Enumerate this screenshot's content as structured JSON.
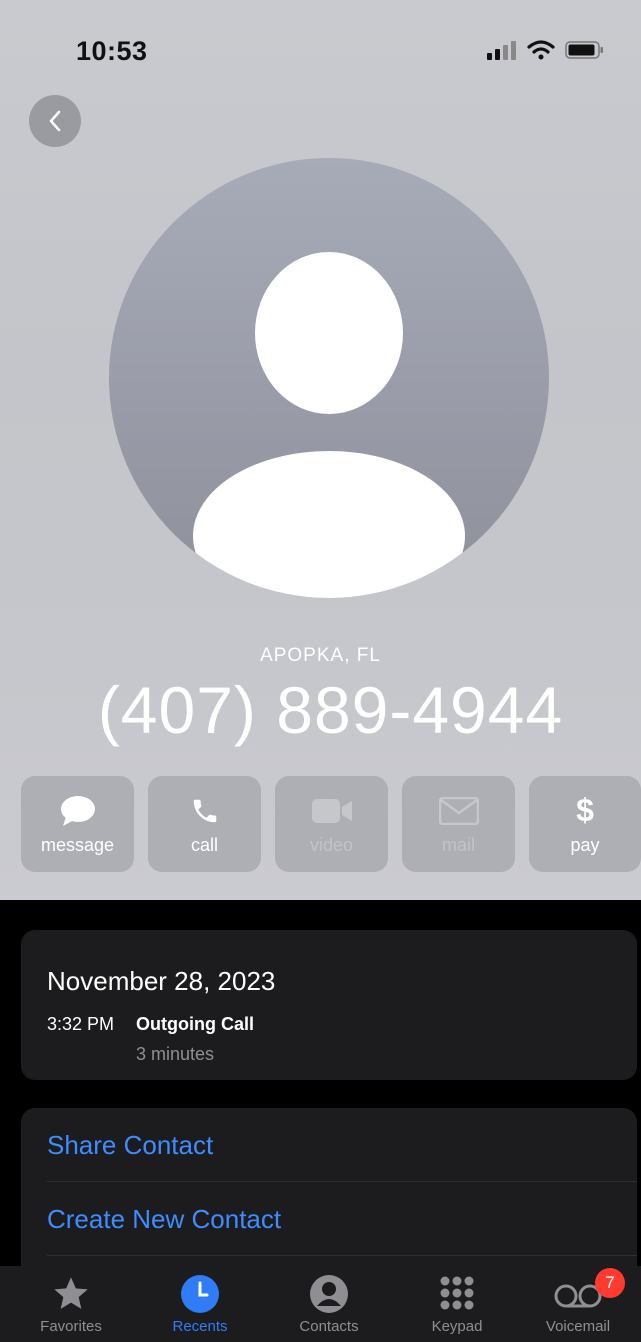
{
  "status_bar": {
    "time": "10:53"
  },
  "contact": {
    "location": "APOPKA, FL",
    "phone": "(407) 889-4944"
  },
  "actions": [
    {
      "label": "message",
      "icon": "message-icon",
      "enabled": true
    },
    {
      "label": "call",
      "icon": "phone-icon",
      "enabled": true
    },
    {
      "label": "video",
      "icon": "video-icon",
      "enabled": false
    },
    {
      "label": "mail",
      "icon": "mail-icon",
      "enabled": false
    },
    {
      "label": "pay",
      "icon": "dollar-icon",
      "enabled": true
    }
  ],
  "call_log": {
    "date": "November 28, 2023",
    "time": "3:32 PM",
    "type": "Outgoing Call",
    "duration": "3 minutes"
  },
  "links": {
    "share": "Share Contact",
    "create": "Create New Contact"
  },
  "tabbar": {
    "favorites": "Favorites",
    "recents": "Recents",
    "contacts": "Contacts",
    "keypad": "Keypad",
    "voicemail": "Voicemail",
    "voicemail_badge": "7",
    "active_color": "#2f7cf6"
  }
}
